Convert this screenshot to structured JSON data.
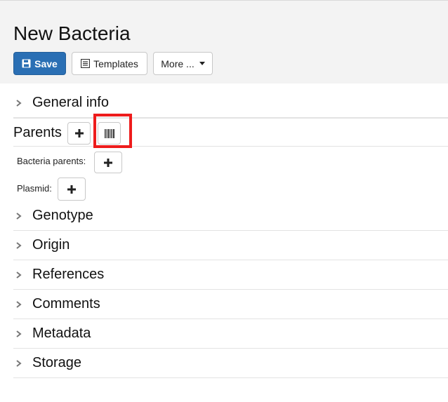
{
  "page": {
    "title": "New Bacteria"
  },
  "toolbar": {
    "save_label": "Save",
    "templates_label": "Templates",
    "more_label": "More ..."
  },
  "sections": {
    "general_info": "General info",
    "genotype": "Genotype",
    "origin": "Origin",
    "references": "References",
    "comments": "Comments",
    "metadata": "Metadata",
    "storage": "Storage"
  },
  "parents": {
    "label": "Parents",
    "bacteria_parents_label": "Bacteria parents:",
    "plasmid_label": "Plasmid:"
  },
  "icons": {
    "save": "floppy-disk-icon",
    "templates": "list-icon",
    "more": "caret-down-icon",
    "section": "chevron-right-icon",
    "add": "plus-icon",
    "barcode": "barcode-icon"
  },
  "colors": {
    "primary": "#2a6fb4",
    "highlight": "#ee1c1c"
  }
}
